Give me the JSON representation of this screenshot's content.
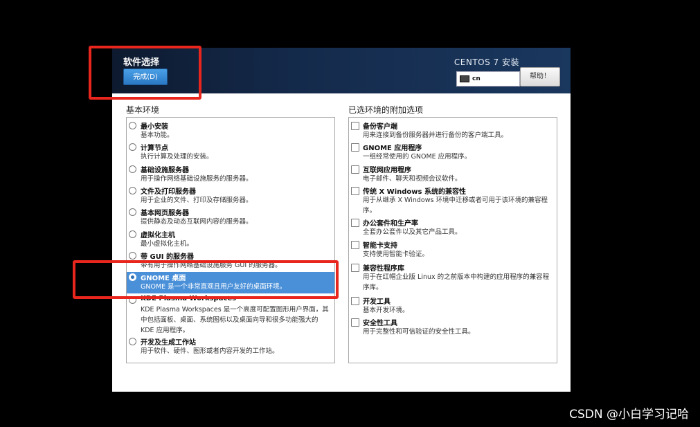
{
  "header": {
    "spoke_title": "软件选择",
    "done_label": "完成(D)",
    "product_title": "CENTOS 7 安装",
    "keyboard_layout": "cn",
    "help_label": "帮助！"
  },
  "base_env": {
    "heading": "基本环境",
    "items": [
      {
        "name": "最小安装",
        "desc": "基本功能。"
      },
      {
        "name": "计算节点",
        "desc": "执行计算及处理的安装。"
      },
      {
        "name": "基础设施服务器",
        "desc": "用于操作网络基础设施服务的服务器。"
      },
      {
        "name": "文件及打印服务器",
        "desc": "用于企业的文件、打印及存储服务器。"
      },
      {
        "name": "基本网页服务器",
        "desc": "提供静态及动态互联网内容的服务器。"
      },
      {
        "name": "虚拟化主机",
        "desc": "最小虚拟化主机。"
      },
      {
        "name": "带 GUI 的服务器",
        "desc": "带有用于操作网络基础设施服务 GUI 的服务器。"
      },
      {
        "name": "GNOME 桌面",
        "desc": "GNOME 是一个非常直观且用户友好的桌面环境。"
      },
      {
        "name": "KDE Plasma Workspaces",
        "desc": "KDE Plasma Workspaces 是一个高度可配置图形用户界面，其中包括面板、桌面、系统图标以及桌面向导和很多功能强大的 KDE 应用程序。"
      },
      {
        "name": "开发及生成工作站",
        "desc": "用于软件、硬件、图形或者内容开发的工作站。"
      }
    ],
    "selected": "GNOME 桌面"
  },
  "addons": {
    "heading": "已选环境的附加选项",
    "items": [
      {
        "name": "备份客户端",
        "desc": "用来连接到备份服务器并进行备份的客户端工具。"
      },
      {
        "name": "GNOME 应用程序",
        "desc": "一组经常使用的 GNOME 应用程序。"
      },
      {
        "name": "互联网应用程序",
        "desc": "电子邮件、聊天和视频会议软件。"
      },
      {
        "name": "传统 X Windows 系统的兼容性",
        "desc": "用于从继承 X Windows 环境中迁移或者可用于该环境的兼容程序。"
      },
      {
        "name": "办公套件和生产率",
        "desc": "全套办公套件以及其它产品工具。"
      },
      {
        "name": "智能卡支持",
        "desc": "支持使用智能卡验证。"
      },
      {
        "name": "兼容性程序库",
        "desc": "用于在红帽企业版 Linux 的之前版本中构建的应用程序的兼容程序库。"
      },
      {
        "name": "开发工具",
        "desc": "基本开发环境。"
      },
      {
        "name": "安全性工具",
        "desc": "用于完整性和可信验证的安全性工具。"
      }
    ]
  },
  "watermark": "CSDN @小白学习记哈"
}
